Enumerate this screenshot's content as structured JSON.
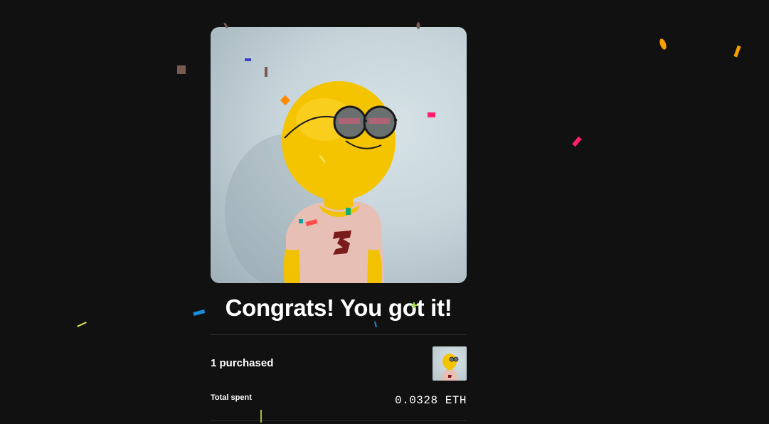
{
  "modal": {
    "title": "Congrats! You got it!",
    "purchased_label": "1 purchased",
    "total_label": "Total spent",
    "total_value": "0.0328 ETH"
  },
  "hero_image": {
    "subject": "yellow clay character with round sunglasses and pink t-shirt"
  },
  "thumbnail": {
    "subject": "yellow clay character thumbnail"
  },
  "colors": {
    "background": "#111111",
    "text": "#ffffff",
    "divider": "#2c2c2c"
  }
}
